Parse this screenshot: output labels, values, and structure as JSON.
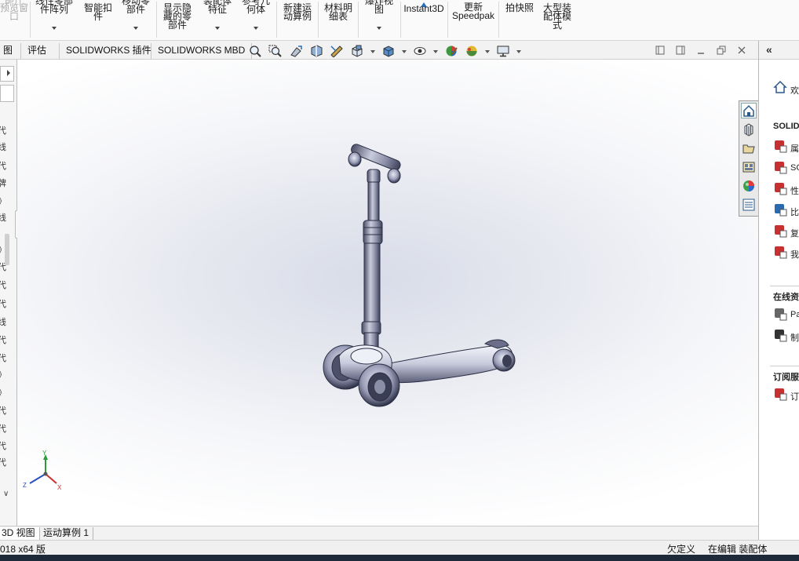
{
  "ribbon": {
    "buttons": [
      {
        "label": "部件\n预览窗\n口"
      },
      {
        "label": "线性零部\n件阵列"
      },
      {
        "label": "智能扣\n件"
      },
      {
        "label": "移动零\n部件"
      },
      {
        "label": "显示隐\n藏的零\n部件"
      },
      {
        "label": "装配体\n特征"
      },
      {
        "label": "参考几\n何体"
      },
      {
        "label": "新建运\n动算例"
      },
      {
        "label": "材料明\n细表"
      },
      {
        "label": "爆炸视\n图"
      },
      {
        "label": "Instant3D"
      },
      {
        "label": "更新\nSpeedpak"
      },
      {
        "label": "拍快照"
      },
      {
        "label": "大型装\n配体模\n式"
      }
    ]
  },
  "tabs": [
    "评估",
    "SOLIDWORKS 插件",
    "SOLIDWORKS MBD"
  ],
  "tabrow_partial_label": "图",
  "view_tools": [
    "zoom-to-fit-icon",
    "zoom-area-icon",
    "previous-view-icon",
    "section-view-icon",
    "dynamic-annotation-icon",
    "view-orientation-icon",
    "display-style-icon",
    "hide-show-icon",
    "edit-appearance-icon",
    "apply-scene-icon",
    "view-settings-icon"
  ],
  "left_panel": {
    "chars": [
      "代",
      "线",
      "代",
      "牌",
      "》",
      "线",
      "》",
      "代",
      "代",
      "代",
      "线",
      "代",
      "代",
      "》",
      "》",
      "代",
      "代",
      "代",
      "代"
    ]
  },
  "model": {
    "name": "scooter",
    "axes": {
      "x": "X",
      "y": "Y",
      "z": "Z"
    }
  },
  "task_pane": {
    "welcome_partial": "欢",
    "section1": "SOLIDW",
    "section1_items": [
      "属",
      "SC",
      "性",
      "比",
      "复",
      "我"
    ],
    "section2": "在线资",
    "section2_items": [
      "Pa",
      "制"
    ],
    "section3": "订阅服",
    "section3_items": [
      "订"
    ]
  },
  "bottom_tabs": [
    "3D 视图",
    "运动算例 1"
  ],
  "status": {
    "left": "018 x64 版",
    "right1": "欠定义",
    "right2": "在编辑 装配体"
  }
}
